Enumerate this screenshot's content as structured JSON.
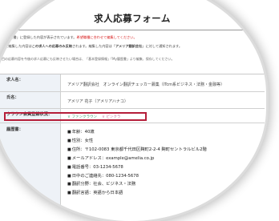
{
  "header": {
    "title": "求人応募フォーム",
    "notice_tag": "★"
  },
  "notices": [
    {
      "text": "My履歴書」に登録した内容が表示されています。",
      "red": "希望職種に合わせて編集してください。"
    },
    {
      "text": "こで編集した内容は",
      "bold": "この求人への応募のみ反映",
      "text2": "されます。編集した内容は「",
      "bold2": "アメリア翻訳会社",
      "text3": "」に対して通知されます。"
    }
  ],
  "small_note": "目の応募内容を今後の求人応募にも反映させたい場合は、「基本登録情報」「My履歴書」より編集、保存してください。",
  "form": {
    "rows": [
      {
        "label": "求人名：",
        "value": "アメリア翻訳会社　オンライン翻訳チェッカー募集（ITcm系ビジネス・法務・金融等）"
      },
      {
        "label": "氏名：",
        "value": "アメリア 花子（アメリアハナコ）"
      },
      {
        "label": "クラウン会員登録状況：",
        "options": [
          "ファンクラウン",
          "ピンクラ"
        ]
      },
      {
        "label": "履歴書："
      }
    ],
    "resume": [
      "年齢：40歳",
      "性別：女性",
      "住所：〒102-0083 東京都千代田区麹町2-2-4 麹町セントラルビル2階",
      "メールアドレス：example@amelia.co.jp",
      "電話番号：03-1234-5678",
      "日中のご連絡先：080-1234-5678",
      "翻訳分野：社会、ビジネス・法務",
      "翻訳言語：英語から日本語"
    ]
  }
}
